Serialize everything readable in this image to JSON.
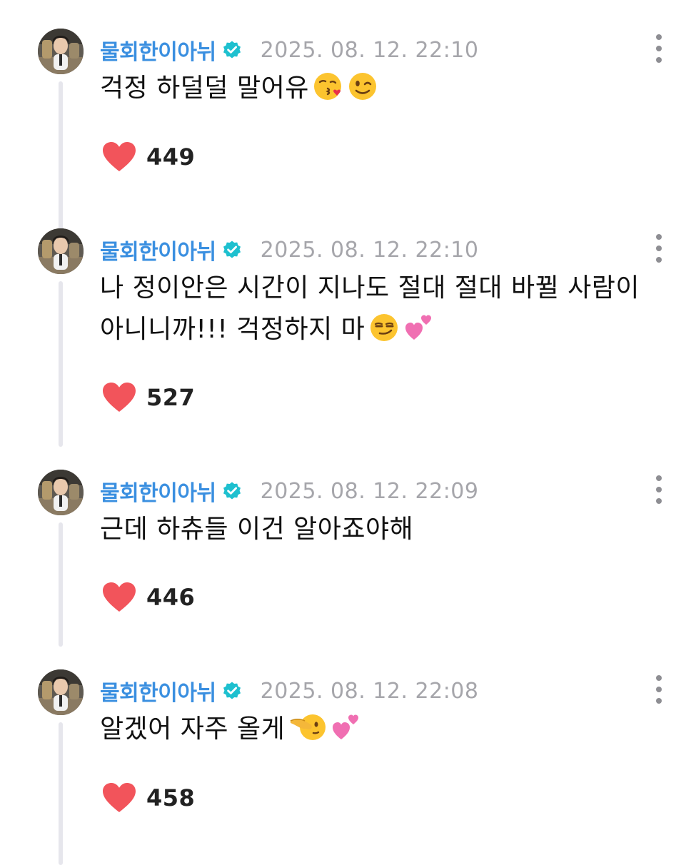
{
  "comments": [
    {
      "username": "물회한이아뉘",
      "timestamp": "2025. 08. 12. 22:10",
      "text_lines": [
        "걱정 하덜덜 말어유"
      ],
      "emojis": [
        "kissing-heart-emoji",
        "winking-face-emoji"
      ],
      "likes": "449"
    },
    {
      "username": "물회한이아뉘",
      "timestamp": "2025. 08. 12. 22:10",
      "text_lines": [
        "나 정이안은 시간이 지나도 절대 절대 바뀔 사람이",
        "아니니까!!! 걱정하지 마"
      ],
      "emojis": [
        "smirking-face-emoji",
        "two-hearts-emoji"
      ],
      "likes": "527"
    },
    {
      "username": "물회한이아뉘",
      "timestamp": "2025. 08. 12. 22:09",
      "text_lines": [
        "근데 하츄들 이건 알아죠야해"
      ],
      "emojis": [],
      "likes": "446"
    },
    {
      "username": "물회한이아뉘",
      "timestamp": "2025. 08. 12. 22:08",
      "text_lines": [
        "알겠어 자주 올게"
      ],
      "emojis": [
        "pointing-face-emoji",
        "two-hearts-emoji"
      ],
      "likes": "458"
    }
  ],
  "colors": {
    "username": "#3a8fe0",
    "verified_badge": "#1ec0cf",
    "timestamp": "#a6a6ab",
    "heart": "#f2545b",
    "thread_line": "#e6e6ec"
  },
  "icons": {
    "verified": "verified-badge-icon",
    "more": "more-vertical-icon",
    "like": "heart-icon"
  }
}
